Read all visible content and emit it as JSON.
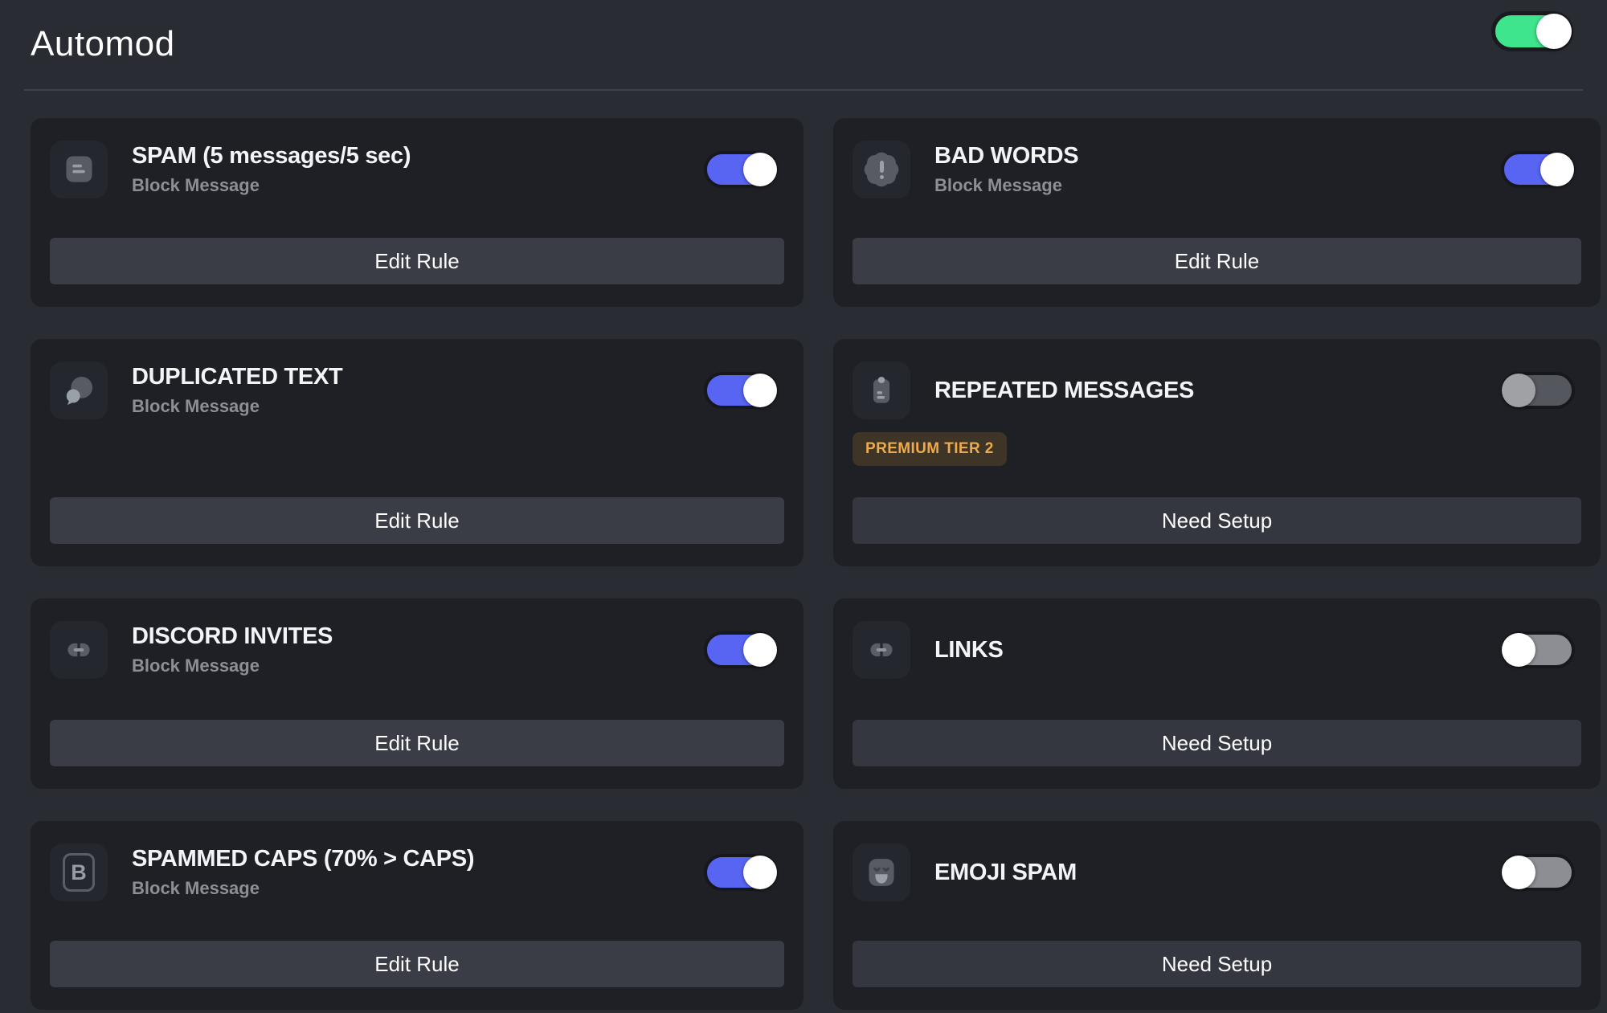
{
  "header": {
    "title": "Automod"
  },
  "master_toggle": {
    "label": "automod-enabled",
    "state": "on"
  },
  "colors": {
    "page_bg": "#2a2c33",
    "card_bg": "#1e2026",
    "accent_blue": "#5865f2",
    "accent_green": "#3ee58d",
    "badge_bg": "#3e3526",
    "badge_text": "#eeaa4e",
    "button_bg": "#3a3d46"
  },
  "glyphs": {
    "bold": "B"
  },
  "cards": [
    {
      "title": "SPAM (5 messages/5 sec)",
      "subtitle": "Block Message",
      "button": "Edit Rule",
      "icon": "message-lines-icon",
      "toggle_state": "on"
    },
    {
      "title": "BAD WORDS",
      "subtitle": "Block Message",
      "button": "Edit Rule",
      "icon": "badge-exclamation-icon",
      "toggle_state": "on"
    },
    {
      "title": "DUPLICATED TEXT",
      "subtitle": "Block Message",
      "button": "Edit Rule",
      "icon": "chat-bubbles-icon",
      "toggle_state": "on"
    },
    {
      "title": "REPEATED MESSAGES",
      "badge": "PREMIUM TIER 2",
      "button": "Need Setup",
      "icon": "clipboard-icon",
      "toggle_state": "off"
    },
    {
      "title": "DISCORD INVITES",
      "subtitle": "Block Message",
      "button": "Edit Rule",
      "icon": "link-icon",
      "toggle_state": "on"
    },
    {
      "title": "LINKS",
      "button": "Need Setup",
      "icon": "link-icon",
      "toggle_state": "off"
    },
    {
      "title": "SPAMMED CAPS (70% > CAPS)",
      "subtitle": "Block Message",
      "button": "Edit Rule",
      "icon": "bold-icon",
      "toggle_state": "on"
    },
    {
      "title": "EMOJI SPAM",
      "button": "Need Setup",
      "icon": "emoji-face-icon",
      "toggle_state": "off"
    }
  ]
}
